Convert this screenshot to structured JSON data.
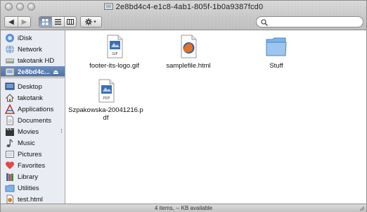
{
  "window": {
    "title": "2e8bd4c4-e1c8-4ab1-805f-1b0a9387fcd0",
    "status_text": "4 items, -- KB available"
  },
  "toolbar": {
    "back_label": "◀",
    "forward_label": "▶",
    "view_icon_label": "▪▪",
    "view_list_label": "≡",
    "view_column_label": "▥",
    "action_label": "⚙▾",
    "search_value": ""
  },
  "sidebar": {
    "devices": [
      {
        "label": "iDisk",
        "icon": "idisk-icon"
      },
      {
        "label": "Network",
        "icon": "network-icon"
      },
      {
        "label": "takotank HD",
        "icon": "harddisk-icon"
      },
      {
        "label": "2e8bd4c...",
        "icon": "disk-image-icon",
        "selected": true,
        "eject": "⏏"
      }
    ],
    "places": [
      {
        "label": "Desktop",
        "icon": "desktop-icon"
      },
      {
        "label": "takotank",
        "icon": "home-icon"
      },
      {
        "label": "Applications",
        "icon": "applications-icon"
      },
      {
        "label": "Documents",
        "icon": "documents-icon"
      },
      {
        "label": "Movies",
        "icon": "movies-icon"
      },
      {
        "label": "Music",
        "icon": "music-icon"
      },
      {
        "label": "Pictures",
        "icon": "pictures-icon"
      },
      {
        "label": "Favorites",
        "icon": "favorites-icon"
      },
      {
        "label": "Library",
        "icon": "library-icon"
      },
      {
        "label": "Utilities",
        "icon": "utilities-icon"
      },
      {
        "label": "test.html",
        "icon": "html-file-icon"
      }
    ]
  },
  "files": [
    {
      "label": "footer-its-logo.gif",
      "icon": "gif-file-icon",
      "badge": "GIF"
    },
    {
      "label": "samplefile.html",
      "icon": "firefox-html-icon"
    },
    {
      "label": "Stuff",
      "icon": "folder-icon"
    },
    {
      "label": "Szpakowska-20041216.pdf",
      "icon": "pdf-file-icon",
      "badge": "PDF"
    }
  ],
  "colors": {
    "selection": "#4a6da3",
    "sidebar_bg": "#e9edf3",
    "folder_blue": "#7fb3e6"
  }
}
